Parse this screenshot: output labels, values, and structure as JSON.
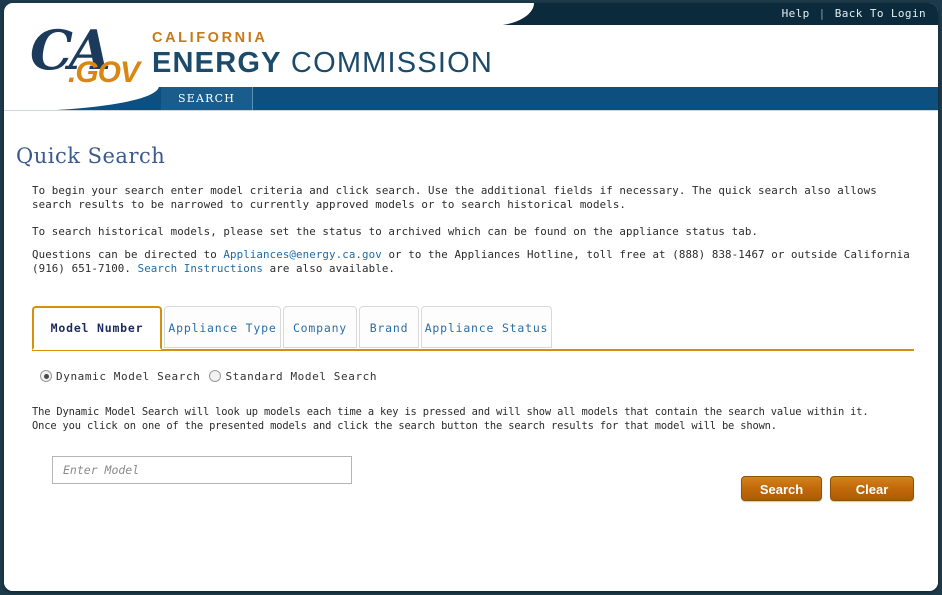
{
  "topbar": {
    "help": "Help",
    "separator": "|",
    "back_to_login": "Back To Login"
  },
  "brand": {
    "logo_ca": "CA",
    "logo_gov": ".GOV",
    "line1": "CALIFORNIA",
    "line2_bold": "ENERGY",
    "line2_rest": " COMMISSION"
  },
  "nav": {
    "tabs": [
      {
        "label": "SEARCH",
        "active": true
      }
    ]
  },
  "main": {
    "page_title": "Quick Search",
    "paragraph1": "To begin your search enter model criteria and click search. Use the additional fields if necessary. The quick search also allows search results to be narrowed to currently approved models or to search historical models.",
    "paragraph2": "To search historical models, please set the status to archived which can be found on the appliance status tab.",
    "paragraph3_part1": "Questions can be directed to ",
    "paragraph3_link1": "Appliances@energy.ca.gov",
    "paragraph3_part2": " or to the Appliances Hotline, toll free at (888) 838-1467 or outside California (916) 651-7100. ",
    "paragraph3_link2": "Search Instructions",
    "paragraph3_part3": " are also available.",
    "tabs": [
      {
        "label": "Model Number",
        "active": true
      },
      {
        "label": "Appliance Type",
        "active": false
      },
      {
        "label": "Company",
        "active": false
      },
      {
        "label": "Brand",
        "active": false
      },
      {
        "label": "Appliance Status",
        "active": false
      }
    ],
    "radios": [
      {
        "label": "Dynamic Model Search",
        "checked": true
      },
      {
        "label": "Standard Model Search",
        "checked": false
      }
    ],
    "dynamic_description_line1": "The Dynamic Model Search will look up models each time a key is pressed and will show all models that contain the search value within it.",
    "dynamic_description_line2": "Once you click on one of the presented models and click the search button the search results for that model will be shown.",
    "model_input_value": "",
    "model_input_placeholder": "Enter Model",
    "search_button": "Search",
    "clear_button": "Clear"
  },
  "colors": {
    "topbar_navy": "#0b2b3c",
    "navbar_blue": "#0d5080",
    "accent_orange": "#d5900f",
    "button_orange": "#c1690a",
    "link_blue": "#1f6ba5",
    "title_blue": "#3a5a8c",
    "page_background": "#1d3a4a"
  }
}
